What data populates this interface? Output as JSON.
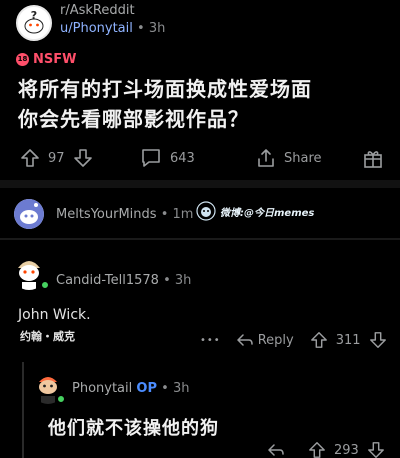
{
  "post": {
    "subreddit": "r/AskReddit",
    "author": "u/Phonytail",
    "age": "3h",
    "nsfw_label": "NSFW",
    "title_line1": "将所有的打斗场面换成性爱场面",
    "title_line2": "你会先看哪部影视作品？",
    "upvotes": "97",
    "comments": "643",
    "share_label": "Share"
  },
  "collapsed_comment": {
    "username": "MeltsYourMinds",
    "age": "1m",
    "watermark": "微博:@今日memes"
  },
  "comment1": {
    "username": "Candid-Tell1578",
    "age": "3h",
    "body": "John Wick.",
    "subtitle": "约翰・威克",
    "more": "•••",
    "reply_label": "Reply",
    "votes": "311"
  },
  "comment2": {
    "username": "Phonytail",
    "op_label": "OP",
    "age": "3h",
    "body": "他们就不该操他的狗",
    "votes": "293"
  },
  "colors": {
    "background": "#000000",
    "nsfw": "#ff4f6a",
    "op": "#4c8dff",
    "link": "#8fb3ff"
  }
}
